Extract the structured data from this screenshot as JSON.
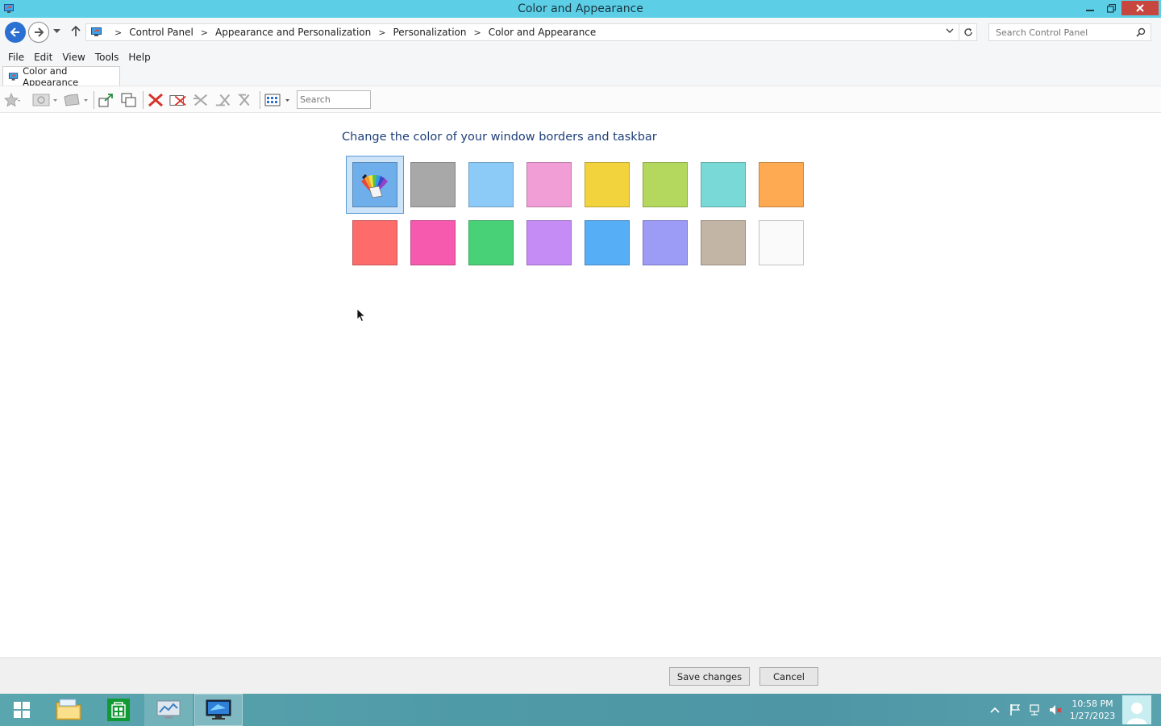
{
  "window": {
    "title": "Color and Appearance"
  },
  "address": {
    "crumbs": [
      "Control Panel",
      "Appearance and Personalization",
      "Personalization",
      "Color and Appearance"
    ],
    "search_placeholder": "Search Control Panel"
  },
  "menu": {
    "items": [
      "File",
      "Edit",
      "View",
      "Tools",
      "Help"
    ]
  },
  "tab": {
    "label": "Color and Appearance"
  },
  "toolbar": {
    "search_placeholder": "Search"
  },
  "main": {
    "heading": "Change the color of your window borders and taskbar",
    "swatches": [
      {
        "name": "automatic",
        "color": "#6eaeeb",
        "selected": true
      },
      {
        "name": "gray",
        "color": "#a8a8a8"
      },
      {
        "name": "light-blue",
        "color": "#8ccbf8"
      },
      {
        "name": "pink",
        "color": "#f19ed6"
      },
      {
        "name": "yellow",
        "color": "#f2d33d"
      },
      {
        "name": "lime",
        "color": "#b4d85e"
      },
      {
        "name": "teal",
        "color": "#79d9d6"
      },
      {
        "name": "orange",
        "color": "#fdaa53"
      },
      {
        "name": "red",
        "color": "#fd6b6b"
      },
      {
        "name": "magenta",
        "color": "#f65aae"
      },
      {
        "name": "green",
        "color": "#49d178"
      },
      {
        "name": "purple",
        "color": "#c68cf5"
      },
      {
        "name": "blue",
        "color": "#56aef7"
      },
      {
        "name": "periwinkle",
        "color": "#9c9cf7"
      },
      {
        "name": "taupe",
        "color": "#c3b5a6"
      },
      {
        "name": "white",
        "color": "#fafafa"
      }
    ]
  },
  "buttons": {
    "save": "Save changes",
    "cancel": "Cancel"
  },
  "taskbar": {
    "time": "10:58 PM",
    "date": "1/27/2023"
  },
  "colors": {
    "titlebar": "#5ccfe6",
    "heading": "#1e3f7a",
    "selection": "#cde3f8"
  }
}
